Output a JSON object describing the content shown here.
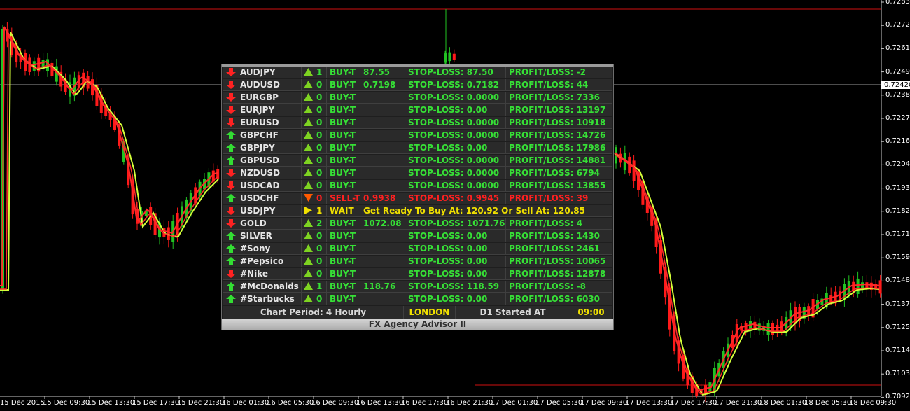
{
  "chart": {
    "price_labels": [
      "0.72835",
      "0.72720",
      "0.72610",
      "0.72495",
      "0.72385",
      "0.72270",
      "0.72160",
      "0.72045",
      "0.71935",
      "0.71820",
      "0.71710",
      "0.71595",
      "0.71480",
      "0.71370",
      "0.71255",
      "0.71145",
      "0.71030",
      "0.70920"
    ],
    "current_price": "0.72420",
    "time_labels": [
      "15 Dec 2015",
      "15 Dec 09:30",
      "15 Dec 13:30",
      "15 Dec 17:30",
      "15 Dec 21:30",
      "16 Dec 01:30",
      "16 Dec 05:30",
      "16 Dec 09:30",
      "16 Dec 13:30",
      "16 Dec 17:30",
      "16 Dec 21:30",
      "17 Dec 01:30",
      "17 Dec 05:30",
      "17 Dec 09:30",
      "17 Dec 13:30",
      "17 Dec 17:30",
      "17 Dec 21:30",
      "18 Dec 01:30",
      "18 Dec 05:30",
      "18 Dec 09:30"
    ],
    "colors": {
      "bull": "#22c322",
      "bear": "#ff1a1a",
      "ma_fast": "#ff2a2a",
      "ma_slow": "#d4ff3a",
      "level": "#d01010"
    }
  },
  "panel": {
    "title": "FX Agency Advisor II",
    "rows": [
      {
        "symbol": "AUDJPY",
        "trend": "down",
        "count": "1",
        "action": "BUY-T",
        "price": "87.55",
        "sl": "STOP-LOSS: 87.50",
        "pl": "PROFIT/LOSS: -2",
        "side": "buy"
      },
      {
        "symbol": "AUDUSD",
        "trend": "down",
        "count": "0",
        "action": "BUY-T",
        "price": "0.7198",
        "sl": "STOP-LOSS: 0.7182",
        "pl": "PROFIT/LOSS: 44",
        "side": "buy"
      },
      {
        "symbol": "EURGBP",
        "trend": "down",
        "count": "0",
        "action": "BUY-T",
        "price": "",
        "sl": "STOP-LOSS: 0.0000",
        "pl": "PROFIT/LOSS: 7336",
        "side": "buy"
      },
      {
        "symbol": "EURJPY",
        "trend": "down",
        "count": "0",
        "action": "BUY-T",
        "price": "",
        "sl": "STOP-LOSS: 0.00",
        "pl": "PROFIT/LOSS: 13197",
        "side": "buy"
      },
      {
        "symbol": "EURUSD",
        "trend": "down",
        "count": "0",
        "action": "BUY-T",
        "price": "",
        "sl": "STOP-LOSS: 0.0000",
        "pl": "PROFIT/LOSS: 10918",
        "side": "buy"
      },
      {
        "symbol": "GBPCHF",
        "trend": "up",
        "count": "0",
        "action": "BUY-T",
        "price": "",
        "sl": "STOP-LOSS: 0.0000",
        "pl": "PROFIT/LOSS: 14726",
        "side": "buy"
      },
      {
        "symbol": "GBPJPY",
        "trend": "up",
        "count": "0",
        "action": "BUY-T",
        "price": "",
        "sl": "STOP-LOSS: 0.00",
        "pl": "PROFIT/LOSS: 17986",
        "side": "buy"
      },
      {
        "symbol": "GBPUSD",
        "trend": "up",
        "count": "0",
        "action": "BUY-T",
        "price": "",
        "sl": "STOP-LOSS: 0.0000",
        "pl": "PROFIT/LOSS: 14881",
        "side": "buy"
      },
      {
        "symbol": "NZDUSD",
        "trend": "down",
        "count": "0",
        "action": "BUY-T",
        "price": "",
        "sl": "STOP-LOSS: 0.0000",
        "pl": "PROFIT/LOSS: 6794",
        "side": "buy"
      },
      {
        "symbol": "USDCAD",
        "trend": "down",
        "count": "0",
        "action": "BUY-T",
        "price": "",
        "sl": "STOP-LOSS: 0.0000",
        "pl": "PROFIT/LOSS: 13855",
        "side": "buy"
      },
      {
        "symbol": "USDCHF",
        "trend": "up",
        "count": "0",
        "action": "SELL-T",
        "price": "0.9938",
        "sl": "STOP-LOSS: 0.9945",
        "pl": "PROFIT/LOSS: 39",
        "side": "sell"
      },
      {
        "symbol": "USDJPY",
        "trend": "down",
        "count": "1",
        "action": "WAIT",
        "message": "Get Ready To Buy At: 120.92 Or Sell At: 120.85",
        "side": "wait"
      },
      {
        "symbol": "GOLD",
        "trend": "down",
        "count": "2",
        "action": "BUY-T",
        "price": "1072.08",
        "sl": "STOP-LOSS: 1071.76",
        "pl": "PROFIT/LOSS: 4",
        "side": "buy"
      },
      {
        "symbol": "SILVER",
        "trend": "up",
        "count": "0",
        "action": "BUY-T",
        "price": "",
        "sl": "STOP-LOSS: 0.00",
        "pl": "PROFIT/LOSS: 1430",
        "side": "buy"
      },
      {
        "symbol": "#Sony",
        "trend": "up",
        "count": "0",
        "action": "BUY-T",
        "price": "",
        "sl": "STOP-LOSS: 0.00",
        "pl": "PROFIT/LOSS: 2461",
        "side": "buy"
      },
      {
        "symbol": "#Pepsico",
        "trend": "up",
        "count": "0",
        "action": "BUY-T",
        "price": "",
        "sl": "STOP-LOSS: 0.00",
        "pl": "PROFIT/LOSS: 10065",
        "side": "buy"
      },
      {
        "symbol": "#Nike",
        "trend": "down",
        "count": "0",
        "action": "BUY-T",
        "price": "",
        "sl": "STOP-LOSS: 0.00",
        "pl": "PROFIT/LOSS: 12878",
        "side": "buy"
      },
      {
        "symbol": "#McDonalds",
        "trend": "up",
        "count": "1",
        "action": "BUY-T",
        "price": "118.76",
        "sl": "STOP-LOSS: 118.59",
        "pl": "PROFIT/LOSS: -8",
        "side": "buy"
      },
      {
        "symbol": "#Starbucks",
        "trend": "up",
        "count": "0",
        "action": "BUY-T",
        "price": "",
        "sl": "STOP-LOSS: 0.00",
        "pl": "PROFIT/LOSS: 6030",
        "side": "buy"
      }
    ],
    "footer": {
      "period": "Chart Period: 4 Hourly",
      "session": "LONDON",
      "d1_label": "D1 Started AT",
      "d1_time": "09:00"
    }
  }
}
